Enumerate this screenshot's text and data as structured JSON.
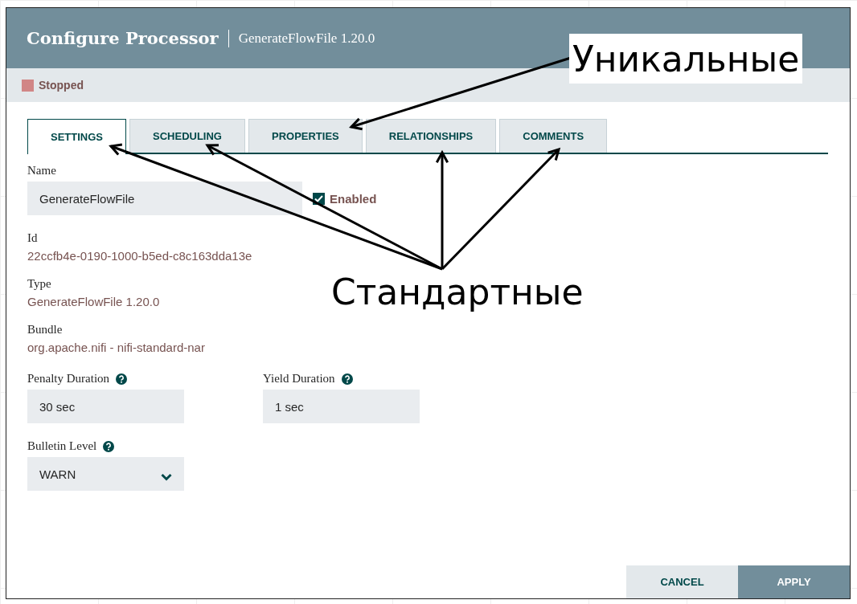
{
  "dialog": {
    "title": "Configure Processor",
    "subtitle": "GenerateFlowFile 1.20.0"
  },
  "status": {
    "label": "Stopped",
    "color": "#d18686"
  },
  "tabs": [
    {
      "label": "SETTINGS",
      "selected": true
    },
    {
      "label": "SCHEDULING",
      "selected": false
    },
    {
      "label": "PROPERTIES",
      "selected": false
    },
    {
      "label": "RELATIONSHIPS",
      "selected": false
    },
    {
      "label": "COMMENTS",
      "selected": false
    }
  ],
  "name_field": {
    "label": "Name",
    "value": "GenerateFlowFile"
  },
  "enabled": {
    "label": "Enabled",
    "checked": true
  },
  "info": [
    {
      "label": "Id",
      "value": "22ccfb4e-0190-1000-b5ed-c8c163dda13e"
    },
    {
      "label": "Type",
      "value": "GenerateFlowFile 1.20.0"
    },
    {
      "label": "Bundle",
      "value": "org.apache.nifi - nifi-standard-nar"
    }
  ],
  "durations": [
    {
      "label": "Penalty Duration",
      "value": "30 sec"
    },
    {
      "label": "Yield Duration",
      "value": "1 sec"
    }
  ],
  "bulletin_level": {
    "label": "Bulletin Level",
    "value": "WARN"
  },
  "buttons": [
    {
      "label": "CANCEL",
      "kind": "secondary"
    },
    {
      "label": "APPLY",
      "kind": "primary"
    }
  ],
  "annotations": [
    {
      "kind": "boxed",
      "text": "Уникальные"
    },
    {
      "kind": "plain",
      "text": "Стандартные"
    }
  ]
}
